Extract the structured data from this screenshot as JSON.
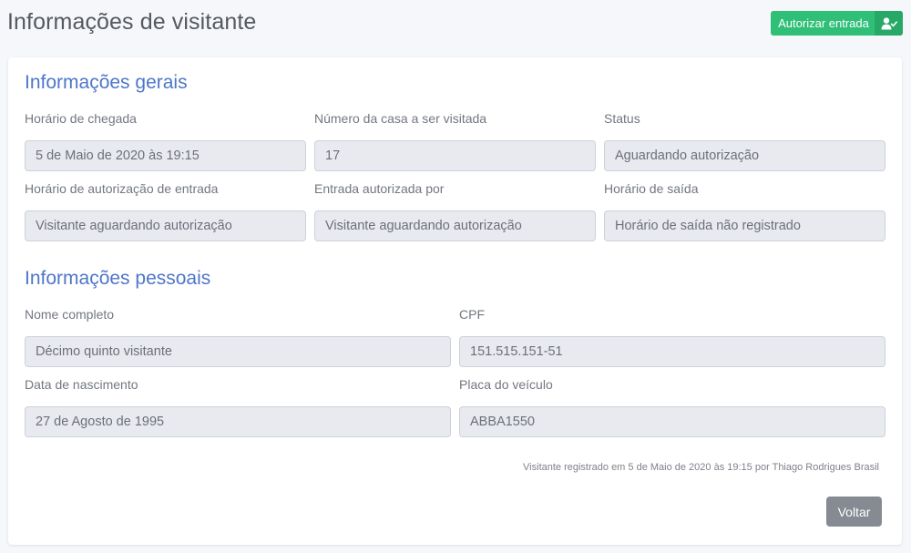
{
  "page": {
    "title": "Informações de visitante",
    "authorize_button": {
      "label": "Autorizar entrada",
      "icon": "user-check-icon"
    }
  },
  "general": {
    "title": "Informações gerais",
    "fields": [
      {
        "label": "Horário de chegada",
        "value": "5 de Maio de 2020 às 19:15"
      },
      {
        "label": "Número da casa a ser visitada",
        "value": "17"
      },
      {
        "label": "Status",
        "value": "Aguardando autorização"
      },
      {
        "label": "Horário de autorização de entrada",
        "value": "Visitante aguardando autorização"
      },
      {
        "label": "Entrada autorizada por",
        "value": "Visitante aguardando autorização"
      },
      {
        "label": "Horário de saída",
        "value": "Horário de saída não registrado"
      }
    ]
  },
  "personal": {
    "title": "Informações pessoais",
    "fields": [
      {
        "label": "Nome completo",
        "value": "Décimo quinto visitante"
      },
      {
        "label": "CPF",
        "value": "151.515.151-51"
      },
      {
        "label": "Data de nascimento",
        "value": "27 de Agosto de 1995"
      },
      {
        "label": "Placa do veículo",
        "value": "ABBA1550"
      }
    ]
  },
  "footer": {
    "note": "Visitante registrado em 5 de Maio de 2020 às 19:15 por Thiago Rodrigues Brasil",
    "back_label": "Voltar"
  },
  "colors": {
    "accent": "#4e76c9",
    "success": "#2fbf77",
    "secondary": "#868b93"
  }
}
